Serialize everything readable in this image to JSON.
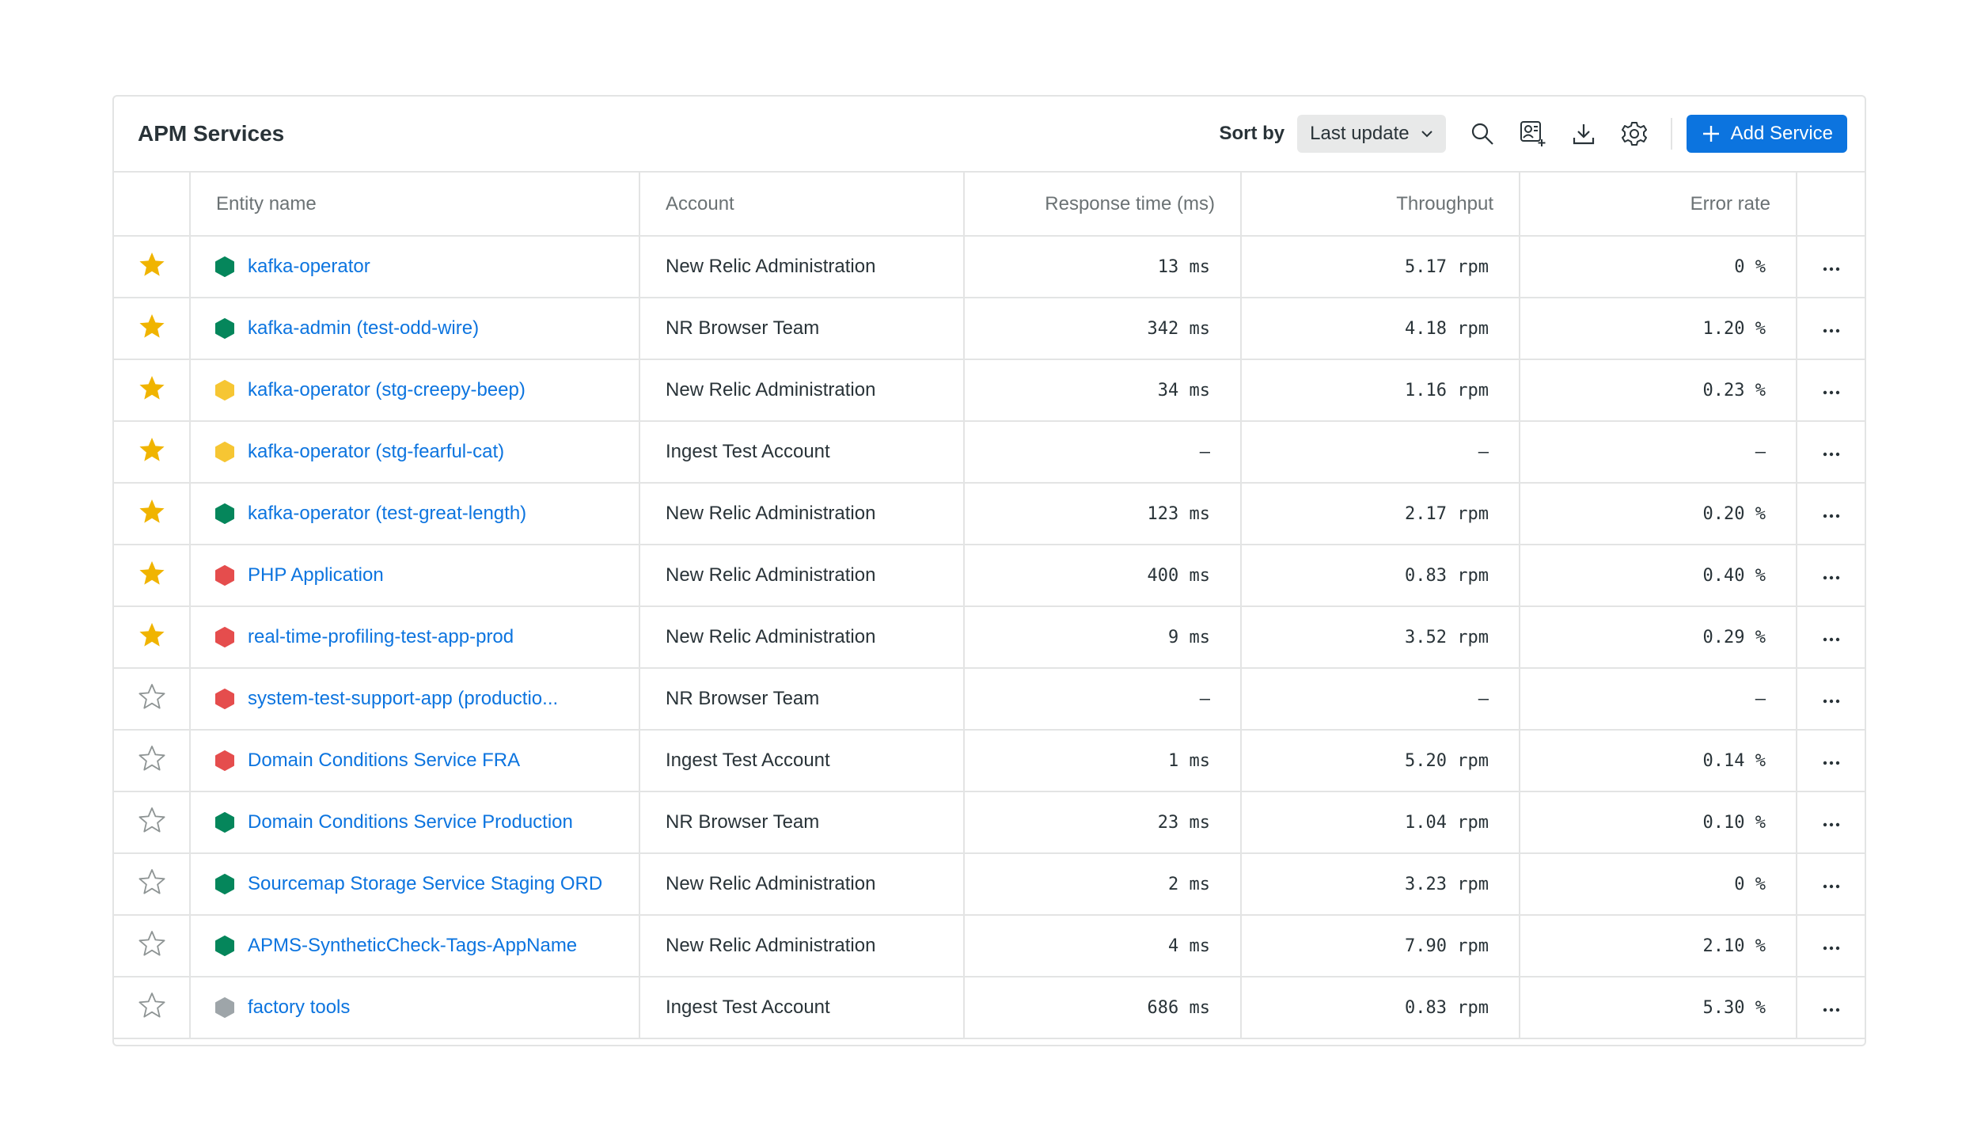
{
  "header": {
    "title": "APM Services",
    "sort_label": "Sort by",
    "sort_value": "Last update",
    "add_label": "Add Service"
  },
  "columns": {
    "entity": "Entity name",
    "account": "Account",
    "response": "Response time (ms)",
    "throughput": "Throughput",
    "error": "Error rate"
  },
  "icons": {
    "search": "search-icon",
    "import": "import-entity-icon",
    "download": "download-icon",
    "settings": "gear-icon",
    "add": "plus-icon",
    "more": "more-icon"
  },
  "status_colors": {
    "green": "#05865b",
    "yellow": "#f6c633",
    "red": "#e54d4d",
    "gray": "#9ea5a9",
    "star": "#f0b400",
    "link": "#0c74df"
  },
  "rows": [
    {
      "favorite": true,
      "status": "green",
      "name": "kafka-operator",
      "account": "New Relic Administration",
      "response": "13 ms",
      "throughput": "5.17 rpm",
      "error": "0 %"
    },
    {
      "favorite": true,
      "status": "green",
      "name": "kafka-admin (test-odd-wire)",
      "account": "NR Browser Team",
      "response": "342 ms",
      "throughput": "4.18 rpm",
      "error": "1.20 %"
    },
    {
      "favorite": true,
      "status": "yellow",
      "name": "kafka-operator (stg-creepy-beep)",
      "account": "New Relic Administration",
      "response": "34 ms",
      "throughput": "1.16 rpm",
      "error": "0.23 %"
    },
    {
      "favorite": true,
      "status": "yellow",
      "name": "kafka-operator (stg-fearful-cat)",
      "account": "Ingest Test Account",
      "response": "–",
      "throughput": "–",
      "error": "–"
    },
    {
      "favorite": true,
      "status": "green",
      "name": "kafka-operator (test-great-length)",
      "account": "New Relic Administration",
      "response": "123 ms",
      "throughput": "2.17 rpm",
      "error": "0.20 %"
    },
    {
      "favorite": true,
      "status": "red",
      "name": "PHP Application",
      "account": "New Relic Administration",
      "response": "400 ms",
      "throughput": "0.83 rpm",
      "error": "0.40 %"
    },
    {
      "favorite": true,
      "status": "red",
      "name": "real-time-profiling-test-app-prod",
      "account": "New Relic Administration",
      "response": "9 ms",
      "throughput": "3.52 rpm",
      "error": "0.29 %"
    },
    {
      "favorite": false,
      "status": "red",
      "name": "system-test-support-app (productio...",
      "account": "NR Browser Team",
      "response": "–",
      "throughput": "–",
      "error": "–"
    },
    {
      "favorite": false,
      "status": "red",
      "name": "Domain Conditions Service FRA",
      "account": "Ingest Test Account",
      "response": "1 ms",
      "throughput": "5.20 rpm",
      "error": "0.14 %"
    },
    {
      "favorite": false,
      "status": "green",
      "name": "Domain Conditions Service Production",
      "account": "NR Browser Team",
      "response": "23 ms",
      "throughput": "1.04 rpm",
      "error": "0.10 %"
    },
    {
      "favorite": false,
      "status": "green",
      "name": "Sourcemap Storage Service Staging ORD",
      "account": "New Relic Administration",
      "response": "2 ms",
      "throughput": "3.23 rpm",
      "error": "0 %"
    },
    {
      "favorite": false,
      "status": "green",
      "name": "APMS-SyntheticCheck-Tags-AppName",
      "account": "New Relic Administration",
      "response": "4 ms",
      "throughput": "7.90 rpm",
      "error": "2.10 %"
    },
    {
      "favorite": false,
      "status": "gray",
      "name": "factory tools",
      "account": "Ingest Test Account",
      "response": "686 ms",
      "throughput": "0.83 rpm",
      "error": "5.30 %"
    }
  ]
}
